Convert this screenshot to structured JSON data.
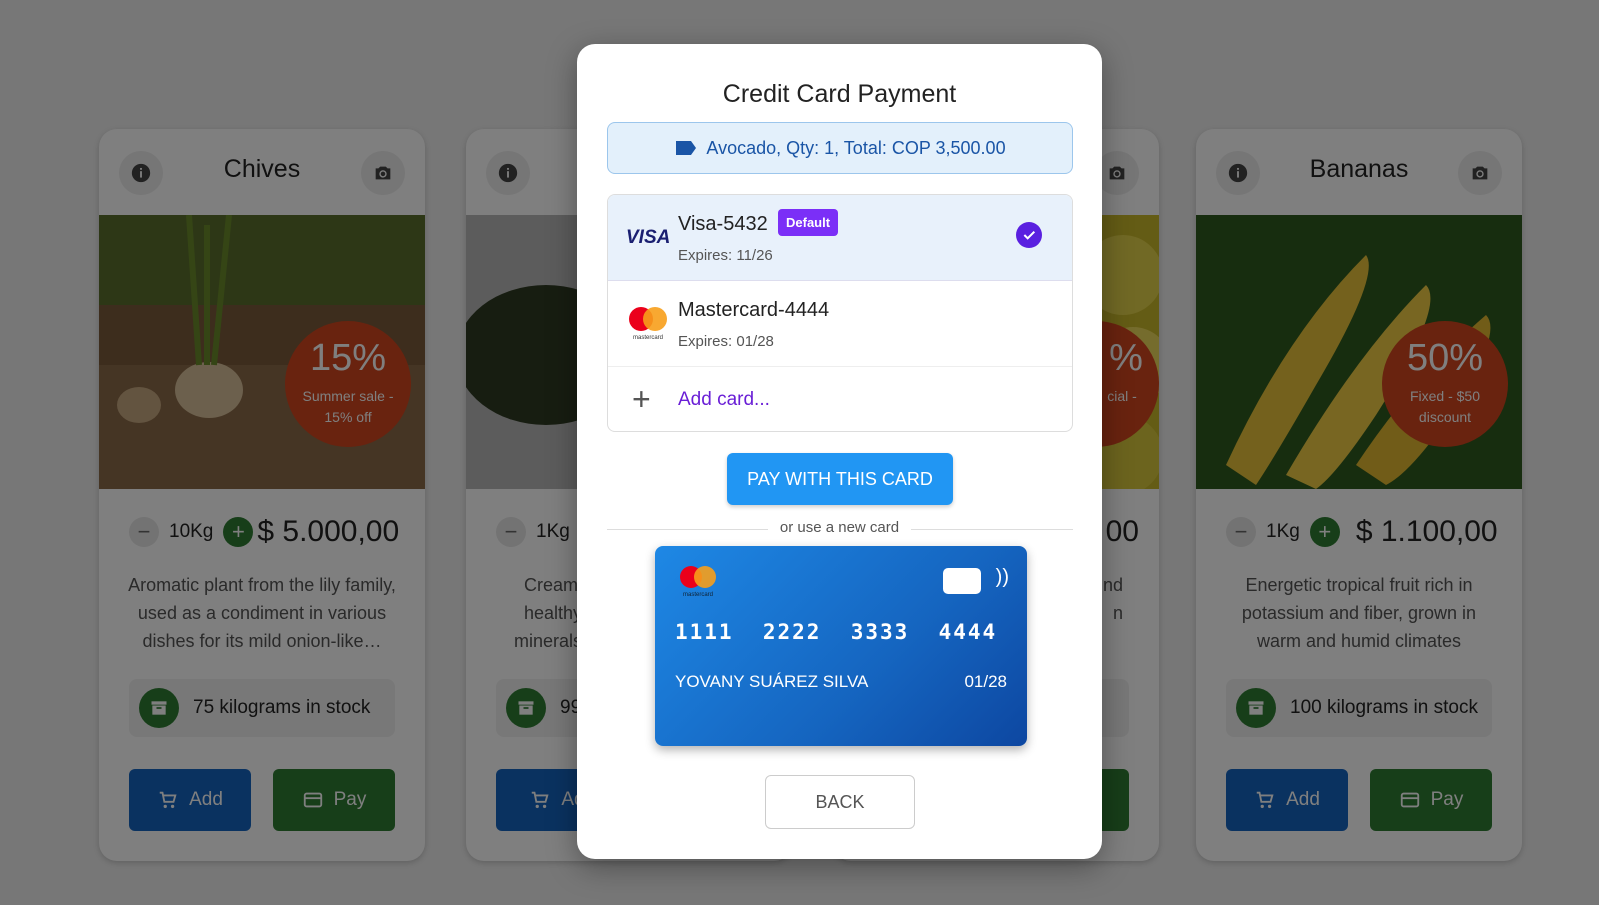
{
  "products": [
    {
      "name": "Chives",
      "discount_pct": "15%",
      "discount_label": "Summer sale - 15% off",
      "qty": "10Kg",
      "price": "$ 5.000,00",
      "description": "Aromatic plant from the lily family, used as a condiment in various dishes for its mild onion-like…",
      "stock": "75 kilograms in stock",
      "add_label": "Add",
      "pay_label": "Pay"
    },
    {
      "name": "",
      "qty": "1Kg",
      "description_partial": [
        "Creamy",
        "healthy",
        "minerals"
      ],
      "stock_partial": "99",
      "add_label_partial": "Ad"
    },
    {
      "name": "",
      "discount_pct_partial": "%",
      "discount_label_partial": "cial -",
      "price_partial": "00",
      "description_partial": [
        "nd",
        "n"
      ]
    },
    {
      "name": "Bananas",
      "discount_pct": "50%",
      "discount_label": "Fixed - $50 discount",
      "qty": "1Kg",
      "price": "$ 1.100,00",
      "description": "Energetic tropical fruit rich in potassium and fiber, grown in warm and humid climates",
      "stock": "100 kilograms in stock",
      "add_label": "Add",
      "pay_label": "Pay"
    }
  ],
  "modal": {
    "title": "Credit Card Payment",
    "summary": "Avocado, Qty: 1, Total: COP 3,500.00",
    "cards": [
      {
        "brand": "VISA",
        "name": "Visa-5432",
        "tag": "Default",
        "expires": "Expires: 11/26"
      },
      {
        "brand": "mastercard",
        "name": "Mastercard-4444",
        "expires": "Expires: 01/28"
      }
    ],
    "add_card_label": "Add card...",
    "pay_button": "PAY WITH THIS CARD",
    "divider_text": "or use a new card",
    "new_card": {
      "brand": "mastercard",
      "number": "1111  2222  3333  4444",
      "holder": "YOVANY SUÁREZ SILVA",
      "expiry": "01/28"
    },
    "back_button": "BACK"
  },
  "colors": {
    "accent_blue": "#2196f3",
    "add_blue": "#1565c0",
    "pay_green": "#2e7d32",
    "discount_red": "#d2461e",
    "default_purple": "#7b2ff7"
  }
}
